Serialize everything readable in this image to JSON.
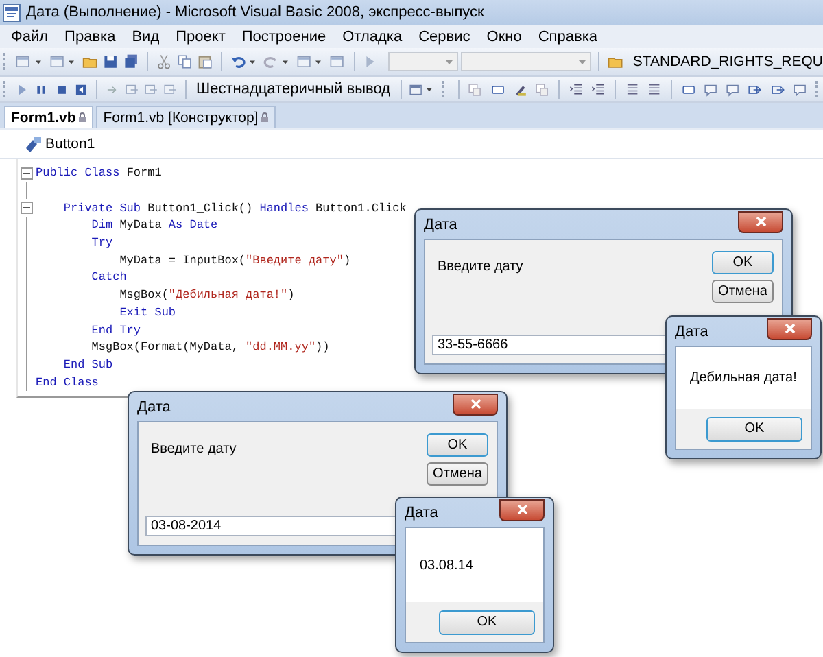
{
  "window": {
    "title": "Дата (Выполнение) - Microsoft Visual Basic 2008, экспресс-выпуск"
  },
  "menu": [
    "Файл",
    "Правка",
    "Вид",
    "Проект",
    "Построение",
    "Отладка",
    "Сервис",
    "Окно",
    "Справка"
  ],
  "toolbar": {
    "symbol": "STANDARD_RIGHTS_REQU",
    "hex_output": "Шестнадцатеричный вывод"
  },
  "tabs": [
    {
      "label": "Form1.vb",
      "selected": true
    },
    {
      "label": "Form1.vb [Конструктор]",
      "selected": false
    }
  ],
  "editor": {
    "object": "Button1",
    "lines": [
      {
        "fold": true,
        "segments": [
          {
            "kind": "kw",
            "text": "Public Class"
          },
          {
            "kind": "plain",
            "text": " Form1"
          }
        ]
      },
      {
        "fold": false
      },
      {
        "fold": true,
        "segments": [
          {
            "kind": "kw",
            "text": "    Private Sub"
          },
          {
            "kind": "plain",
            "text": " Button1_Click() "
          },
          {
            "kind": "kw",
            "text": "Handles"
          },
          {
            "kind": "plain",
            "text": " Button1.Click"
          }
        ]
      },
      {
        "fold": false,
        "segments": [
          {
            "kind": "kw",
            "text": "        Dim"
          },
          {
            "kind": "plain",
            "text": " MyData "
          },
          {
            "kind": "kw",
            "text": "As Date"
          }
        ]
      },
      {
        "fold": false,
        "segments": [
          {
            "kind": "kw",
            "text": "        Try"
          }
        ]
      },
      {
        "fold": false,
        "segments": [
          {
            "kind": "plain",
            "text": "            MyData = InputBox("
          },
          {
            "kind": "str",
            "text": "\"Введите дату\""
          },
          {
            "kind": "plain",
            "text": ")"
          }
        ]
      },
      {
        "fold": false,
        "segments": [
          {
            "kind": "kw",
            "text": "        Catch"
          }
        ]
      },
      {
        "fold": false,
        "segments": [
          {
            "kind": "plain",
            "text": "            MsgBox("
          },
          {
            "kind": "str",
            "text": "\"Дебильная дата!\""
          },
          {
            "kind": "plain",
            "text": ")"
          }
        ]
      },
      {
        "fold": false,
        "segments": [
          {
            "kind": "kw",
            "text": "            Exit Sub"
          }
        ]
      },
      {
        "fold": false,
        "segments": [
          {
            "kind": "kw",
            "text": "        End Try"
          }
        ]
      },
      {
        "fold": false,
        "segments": [
          {
            "kind": "plain",
            "text": "        MsgBox(Format(MyData, "
          },
          {
            "kind": "str",
            "text": "\"dd.MM.yy\""
          },
          {
            "kind": "plain",
            "text": "))"
          }
        ]
      },
      {
        "fold": false,
        "segments": [
          {
            "kind": "kw",
            "text": "    End Sub"
          }
        ]
      },
      {
        "fold": false,
        "segments": [
          {
            "kind": "kw",
            "text": "End Class"
          }
        ]
      }
    ]
  },
  "dialogs": [
    {
      "kind": "input",
      "title": "Дата",
      "prompt": "Введите дату",
      "buttons": [
        "OK",
        "Отмена"
      ],
      "value": "33-55-6666"
    },
    {
      "kind": "message",
      "title": "Дата",
      "message": "Дебильная дата!",
      "buttons": [
        "OK"
      ]
    },
    {
      "kind": "input",
      "title": "Дата",
      "prompt": "Введите дату",
      "buttons": [
        "OK",
        "Отмена"
      ],
      "value": "03-08-2014"
    },
    {
      "kind": "message",
      "title": "Дата",
      "message": "03.08.14",
      "buttons": [
        "OK"
      ]
    }
  ]
}
